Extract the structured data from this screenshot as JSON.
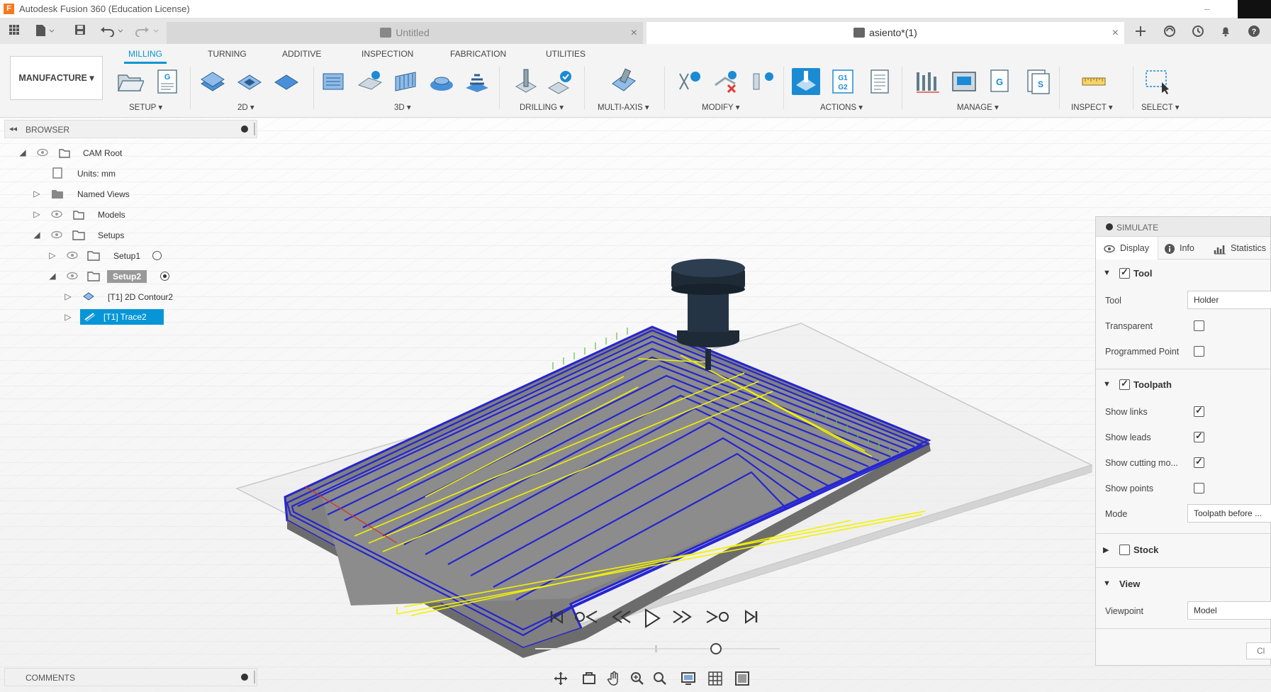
{
  "window": {
    "title": "Autodesk Fusion 360 (Education License)",
    "app_logo": "F",
    "minimize": "–"
  },
  "tabs": [
    {
      "label": "Untitled",
      "close": "×"
    },
    {
      "label": "asiento*(1)",
      "close": "×"
    }
  ],
  "quick_access": {
    "grid_icon": "grid-icon",
    "file_icon": "file-icon",
    "save_icon": "save-icon",
    "undo_icon": "undo-icon",
    "redo_icon": "redo-icon"
  },
  "right_icons": [
    "plus-icon",
    "extensions-icon",
    "job-status-icon",
    "notifications-icon",
    "help-icon"
  ],
  "workspace": {
    "label": "MANUFACTURE ▾"
  },
  "ribbon": {
    "tabs": [
      "MILLING",
      "TURNING",
      "ADDITIVE",
      "INSPECTION",
      "FABRICATION",
      "UTILITIES"
    ],
    "active_tab": "MILLING",
    "groups": [
      "SETUP ▾",
      "2D ▾",
      "3D ▾",
      "DRILLING ▾",
      "MULTI-AXIS ▾",
      "MODIFY ▾",
      "ACTIONS ▾",
      "MANAGE ▾",
      "INSPECT ▾",
      "SELECT ▾"
    ]
  },
  "browser": {
    "title": "BROWSER",
    "collapse": "◂◂",
    "nodes": [
      {
        "label": "CAM Root"
      },
      {
        "label": "Units: mm"
      },
      {
        "label": "Named Views"
      },
      {
        "label": "Models"
      },
      {
        "label": "Setups"
      },
      {
        "label": "Setup1"
      },
      {
        "label": "Setup2"
      },
      {
        "label": "[T1] 2D Contour2"
      },
      {
        "label": "[T1] Trace2"
      }
    ]
  },
  "comments": {
    "title": "COMMENTS"
  },
  "simulate": {
    "title": "SIMULATE",
    "tabs": [
      "Display",
      "Info",
      "Statistics"
    ],
    "tool_section": {
      "title": "Tool",
      "checked": true,
      "props": [
        {
          "label": "Tool",
          "value": "Holder"
        },
        {
          "label": "Transparent",
          "checked": false
        },
        {
          "label": "Programmed Point",
          "checked": false
        }
      ]
    },
    "toolpath_section": {
      "title": "Toolpath",
      "checked": true,
      "props": [
        {
          "label": "Show links",
          "checked": true
        },
        {
          "label": "Show leads",
          "checked": true
        },
        {
          "label": "Show cutting mo...",
          "checked": true
        },
        {
          "label": "Show points",
          "checked": false
        },
        {
          "label": "Mode",
          "value": "Toolpath before ..."
        }
      ]
    },
    "stock_section": {
      "title": "Stock",
      "checked": false
    },
    "view_section": {
      "title": "View",
      "props": [
        {
          "label": "Viewpoint",
          "value": "Model"
        }
      ]
    },
    "close_label": "Cl"
  },
  "playback": {
    "buttons": [
      "⏮",
      "≪○",
      "≪",
      "▷",
      "≫",
      "○≫",
      "⏭"
    ],
    "position": 0.74
  },
  "nav_bar": [
    "orbit-icon",
    "look-at-icon",
    "pan-icon",
    "zoom-icon",
    "fit-icon",
    "display-settings-icon",
    "grid-settings-icon",
    "viewports-icon"
  ],
  "colors": {
    "accent": "#0696d7",
    "toolpath_blue": "#2525d0",
    "toolpath_yellow": "#f2f200",
    "part": "#808080"
  }
}
